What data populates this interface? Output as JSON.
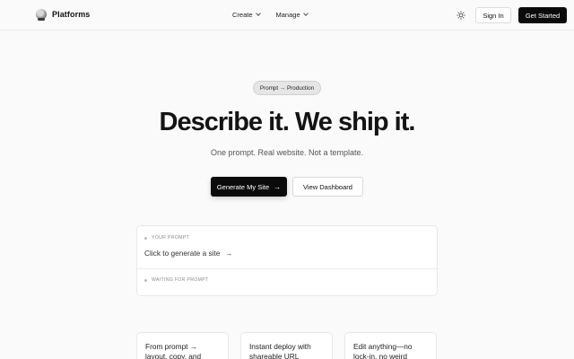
{
  "header": {
    "brand": "Platforms",
    "nav": [
      {
        "label": "Create"
      },
      {
        "label": "Manage"
      }
    ],
    "theme_icon": "sun-icon",
    "sign_in": "Sign In",
    "get_started": "Get Started"
  },
  "hero": {
    "pill": "Prompt → Production",
    "headline": "Describe it. We ship it.",
    "subhead": "One prompt. Real website. Not a template.",
    "primary_button": "Generate My Site",
    "secondary_button": "View Dashboard"
  },
  "prompt_card": {
    "label": "YOUR PROMPT",
    "text": "Click to generate a site",
    "status": "WAITING FOR PROMPT"
  },
  "features": [
    {
      "text": "From prompt → layout, copy, and"
    },
    {
      "text": "Instant deploy with shareable URL"
    },
    {
      "text": "Edit anything—no lock-in, no weird"
    }
  ],
  "colors": {
    "background": "#fafafa",
    "primary": "#0b0b0b",
    "pill_bg": "#e6e6e6"
  }
}
